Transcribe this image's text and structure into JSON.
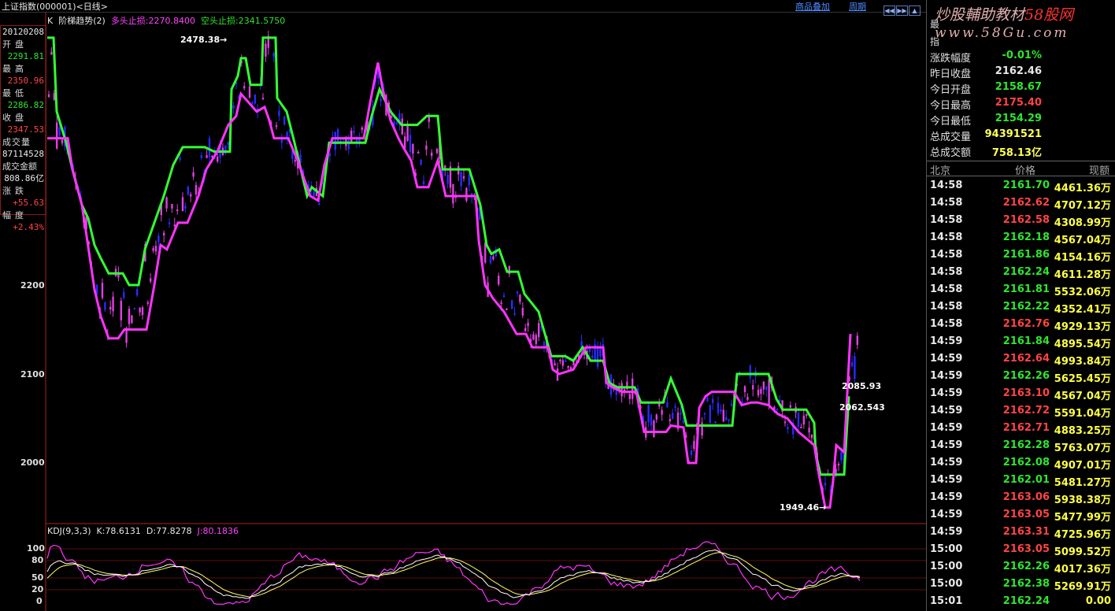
{
  "header": {
    "title": "上证指数(000001)<日线>",
    "link_stack": "商品叠加",
    "link_period": "周期"
  },
  "legend": {
    "k": "K",
    "indicator": "阶梯趋势(2)",
    "long_stop": "多头止损:2270.8400",
    "short_stop": "空头止损:2341.5750"
  },
  "infobox": {
    "date": "20120208",
    "open_label": "开盘",
    "open": "2291.81",
    "high_label": "最高",
    "high": "2350.96",
    "low_label": "最低",
    "low": "2286.82",
    "close_label": "收盘",
    "close": "2347.53",
    "volume_label": "成交量",
    "volume": "87114528",
    "amount_label": "成交金额",
    "amount": "808.86亿",
    "change_label": "涨跌",
    "change": "+55.63",
    "pct_label": "幅度",
    "pct": "+2.43%"
  },
  "annotations": {
    "high": "2478.38",
    "low": "1949.46",
    "right_top": "2085.93",
    "right_mid": "2062.543"
  },
  "y_axis": [
    "2200",
    "2100",
    "2000"
  ],
  "kdj": {
    "name": "KDJ(9,3,3)",
    "k": "K:78.6131",
    "d": "D:77.8278",
    "j": "J:80.1836",
    "levels": [
      "100",
      "80",
      "50",
      "20",
      "0"
    ]
  },
  "side_panel": {
    "watermark_line1": "炒股輔助教材",
    "watermark_brand": "58股网",
    "watermark_line2": "www.58Gu.com",
    "char1": "最",
    "char2": "指",
    "stats": [
      {
        "label": "涨跌幅度",
        "value": "-0.01%",
        "color": "#2ee62e"
      },
      {
        "label": "昨日收盘",
        "value": "2162.46",
        "color": "#e8e8e8"
      },
      {
        "label": "今日开盘",
        "value": "2158.67",
        "color": "#2ee62e"
      },
      {
        "label": "今日最高",
        "value": "2175.40",
        "color": "#ff4444"
      },
      {
        "label": "今日最低",
        "value": "2154.29",
        "color": "#2ee62e"
      },
      {
        "label": "总成交量",
        "value": "94391521",
        "color": "#ffff55"
      },
      {
        "label": "总成交额",
        "value": "758.13亿",
        "color": "#ffff55"
      }
    ],
    "table_headers": {
      "time": "北京",
      "price": "价格",
      "volume": "现额"
    },
    "ticks": [
      {
        "time": "14:58",
        "price": "2161.70",
        "vol": "4461.36万",
        "color": "#2ee62e"
      },
      {
        "time": "14:58",
        "price": "2162.62",
        "vol": "4707.12万",
        "color": "#ff4444"
      },
      {
        "time": "14:58",
        "price": "2162.58",
        "vol": "4308.99万",
        "color": "#ff4444"
      },
      {
        "time": "14:58",
        "price": "2162.18",
        "vol": "4567.04万",
        "color": "#2ee62e"
      },
      {
        "time": "14:58",
        "price": "2161.86",
        "vol": "4154.16万",
        "color": "#2ee62e"
      },
      {
        "time": "14:58",
        "price": "2162.24",
        "vol": "4611.28万",
        "color": "#2ee62e"
      },
      {
        "time": "14:58",
        "price": "2161.81",
        "vol": "5532.06万",
        "color": "#2ee62e"
      },
      {
        "time": "14:58",
        "price": "2162.22",
        "vol": "4352.41万",
        "color": "#2ee62e"
      },
      {
        "time": "14:58",
        "price": "2162.76",
        "vol": "4929.13万",
        "color": "#ff4444"
      },
      {
        "time": "14:59",
        "price": "2161.84",
        "vol": "4895.54万",
        "color": "#2ee62e"
      },
      {
        "time": "14:59",
        "price": "2162.64",
        "vol": "4993.84万",
        "color": "#ff4444"
      },
      {
        "time": "14:59",
        "price": "2162.26",
        "vol": "5625.45万",
        "color": "#2ee62e"
      },
      {
        "time": "14:59",
        "price": "2163.10",
        "vol": "4567.04万",
        "color": "#ff4444"
      },
      {
        "time": "14:59",
        "price": "2162.72",
        "vol": "5591.04万",
        "color": "#ff4444"
      },
      {
        "time": "14:59",
        "price": "2162.71",
        "vol": "4883.25万",
        "color": "#ff4444"
      },
      {
        "time": "14:59",
        "price": "2162.28",
        "vol": "5763.07万",
        "color": "#2ee62e"
      },
      {
        "time": "14:59",
        "price": "2162.08",
        "vol": "4907.01万",
        "color": "#2ee62e"
      },
      {
        "time": "14:59",
        "price": "2162.01",
        "vol": "5481.27万",
        "color": "#2ee62e"
      },
      {
        "time": "14:59",
        "price": "2163.06",
        "vol": "5938.38万",
        "color": "#ff4444"
      },
      {
        "time": "14:59",
        "price": "2163.05",
        "vol": "5477.99万",
        "color": "#ff4444"
      },
      {
        "time": "14:59",
        "price": "2163.31",
        "vol": "4725.96万",
        "color": "#ff4444"
      },
      {
        "time": "15:00",
        "price": "2163.05",
        "vol": "5099.52万",
        "color": "#ff4444"
      },
      {
        "time": "15:00",
        "price": "2162.26",
        "vol": "4017.36万",
        "color": "#2ee62e"
      },
      {
        "time": "15:00",
        "price": "2162.38",
        "vol": "5269.91万",
        "color": "#2ee62e"
      },
      {
        "time": "15:01",
        "price": "2162.24",
        "vol": "0.00",
        "color": "#2ee62e"
      }
    ]
  },
  "colors": {
    "up_stop": "#33ff33",
    "down_stop": "#ff33ff",
    "bear_candle": "#2a2aff",
    "bull_candle": "#e040e0",
    "k_line": "#ffffff",
    "d_line": "#ffff66",
    "j_line": "#ff33ff"
  }
}
